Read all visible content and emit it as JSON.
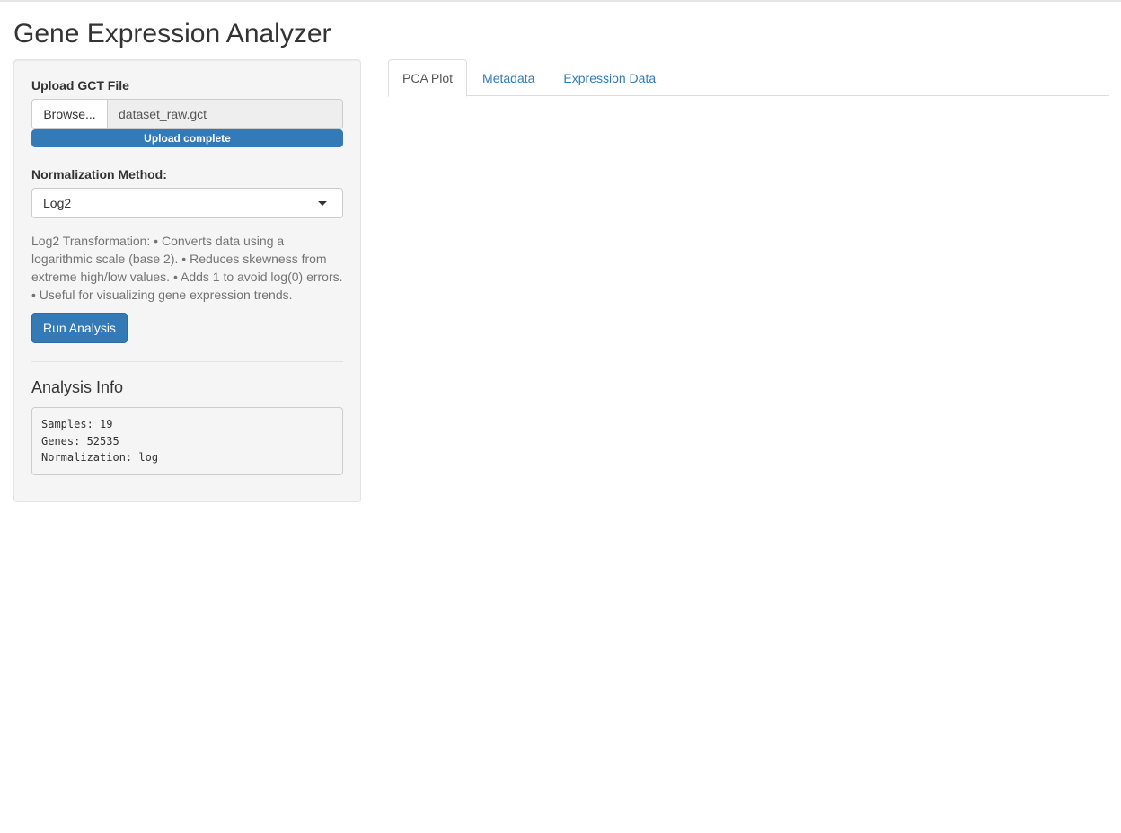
{
  "app": {
    "title": "Gene Expression Analyzer"
  },
  "sidebar": {
    "upload": {
      "label": "Upload GCT File",
      "browse_label": "Browse...",
      "file_name": "dataset_raw.gct",
      "progress_text": "Upload complete",
      "progress_percent": 100
    },
    "normalization": {
      "label": "Normalization Method:",
      "selected": "Log2",
      "description": "Log2 Transformation: • Converts data using a logarithmic scale (base 2). • Reduces skewness from extreme high/low values. • Adds 1 to avoid log(0) errors. • Useful for visualizing gene expression trends."
    },
    "run_button": "Run Analysis",
    "analysis_info": {
      "title": "Analysis Info",
      "lines": [
        "Samples: 19",
        "Genes: 52535",
        "Normalization: log"
      ]
    }
  },
  "main": {
    "tabs": [
      {
        "label": "PCA Plot",
        "active": true
      },
      {
        "label": "Metadata",
        "active": false
      },
      {
        "label": "Expression Data",
        "active": false
      }
    ]
  },
  "colors": {
    "accent": "#337ab7",
    "panel_bg": "#f5f5f5",
    "border": "#cccccc"
  }
}
